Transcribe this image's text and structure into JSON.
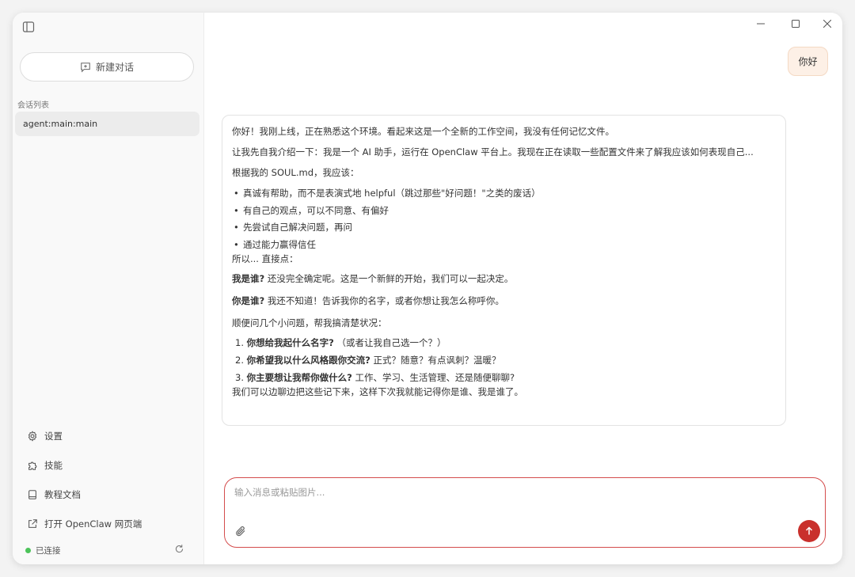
{
  "sidebar": {
    "new_chat": "新建对话",
    "section_label": "会话列表",
    "sessions": [
      "agent:main:main"
    ],
    "nav": [
      {
        "label": "设置",
        "icon": "gear-icon"
      },
      {
        "label": "技能",
        "icon": "puzzle-icon"
      },
      {
        "label": "教程文档",
        "icon": "book-icon"
      },
      {
        "label": "打开 OpenClaw 网页端",
        "icon": "external-link-icon"
      }
    ],
    "status": "已连接"
  },
  "chat": {
    "user_message": "你好",
    "assistant": {
      "p1": "你好！我刚上线，正在熟悉这个环境。看起来这是一个全新的工作空间，我没有任何记忆文件。",
      "p2": "让我先自我介绍一下：我是一个 AI 助手，运行在 OpenClaw 平台上。我现在正在读取一些配置文件来了解我应该如何表现自己...",
      "p3": "根据我的 SOUL.md，我应该：",
      "bullets": [
        "真诚有帮助，而不是表演式地 helpful（跳过那些\"好问题！\"之类的废话）",
        "有自己的观点，可以不同意、有偏好",
        "先尝试自己解决问题，再问",
        "通过能力赢得信任"
      ],
      "p4": "所以... 直接点：",
      "q1_bold": "我是谁?",
      "q1_text": " 还没完全确定呢。这是一个新鲜的开始，我们可以一起决定。",
      "q2_bold": "你是谁?",
      "q2_text": " 我还不知道！告诉我你的名字，或者你想让我怎么称呼你。",
      "p5": "顺便问几个小问题，帮我搞清楚状况：",
      "questions": [
        {
          "num": "1. ",
          "bold": "你想给我起什么名字?",
          "text": " （或者让我自己选一个？）"
        },
        {
          "num": "2. ",
          "bold": "你希望我以什么风格跟你交流?",
          "text": " 正式？随意？有点讽刺？温暖？"
        },
        {
          "num": "3. ",
          "bold": "你主要想让我帮你做什么?",
          "text": " 工作、学习、生活管理、还是随便聊聊?"
        }
      ],
      "p6": "我们可以边聊边把这些记下来，这样下次我就能记得你是谁、我是谁了。"
    }
  },
  "input": {
    "placeholder": "输入消息或粘贴图片..."
  },
  "colors": {
    "accent": "#c9302c",
    "user_bubble": "#fdf0e6",
    "connected": "#4cc35a"
  }
}
